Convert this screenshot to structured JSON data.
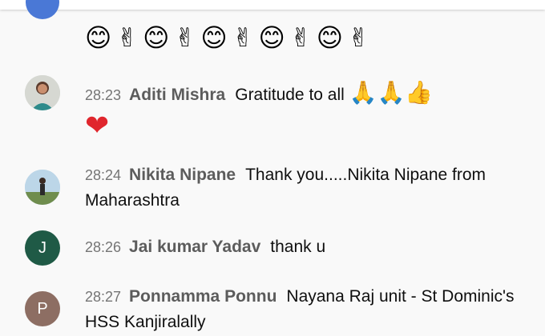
{
  "chat": {
    "prev_emojis": "😊✌😊✌😊✌😊✌😊✌",
    "messages": [
      {
        "time": "28:23",
        "author": "Aditi Mishra",
        "text": "Gratitude to all",
        "emojis": "🙏🙏👍",
        "extra": "❤",
        "avatar": "photo"
      },
      {
        "time": "28:24",
        "author": "Nikita Nipane",
        "text": "Thank you.....Nikita Nipane from Maharashtra",
        "avatar": "photo"
      },
      {
        "time": "28:26",
        "author": "Jai kumar Yadav",
        "text": "thank u",
        "avatar_letter": "J",
        "avatar_color": "#1f5a46"
      },
      {
        "time": "28:27",
        "author": "Ponnamma Ponnu",
        "text": "Nayana Raj unit - St Dominic's HSS Kanjiralally",
        "avatar_letter": "P",
        "avatar_color": "#8d6e63"
      }
    ]
  }
}
